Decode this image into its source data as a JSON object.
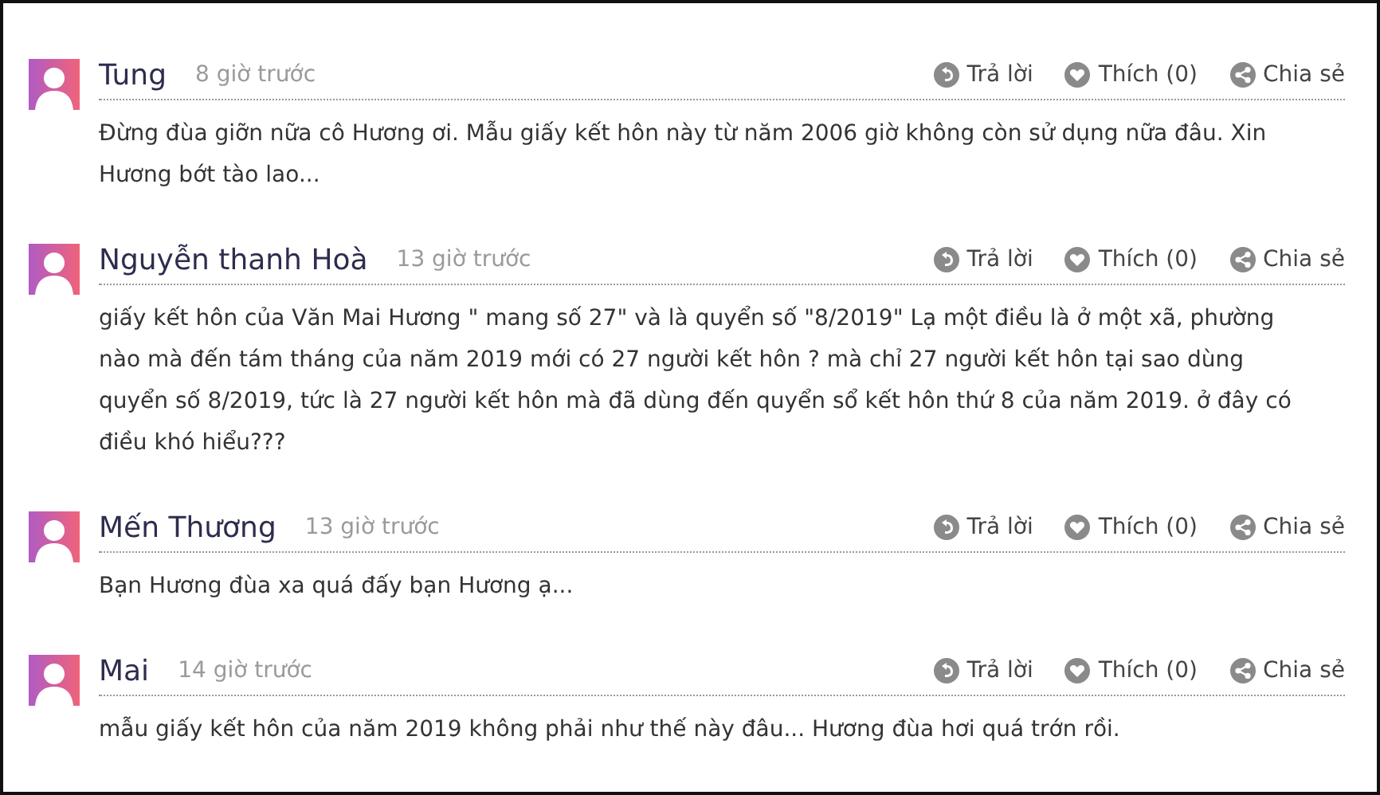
{
  "comments": [
    {
      "author": "Tung",
      "time": "8 giờ trước",
      "actions": [
        "Trả lời",
        "Thích (0)",
        "Chia sẻ"
      ],
      "text": "Đừng đùa giỡn nữa cô Hương ơi. Mẫu giấy kết hôn này từ năm 2006 giờ không còn sử dụng nữa đâu. Xin Hương bớt tào lao..."
    },
    {
      "author": "Nguyễn thanh Hoà",
      "time": "13 giờ trước",
      "actions": [
        "Trả lời",
        "Thích (0)",
        "Chia sẻ"
      ],
      "text": "giấy kết hôn của Văn Mai Hương \" mang số 27\" và là quyển số \"8/2019\" Lạ một điều là ở một xã, phường nào mà đến tám tháng của năm 2019 mới có 27 người kết hôn ? mà chỉ 27 người kết hôn tại sao dùng quyển số 8/2019, tức là 27 người kết hôn mà đã dùng đến quyển sổ kết hôn thứ 8 của năm 2019. ở đây có điều khó hiểu???"
    },
    {
      "author": "Mến Thương",
      "time": "13 giờ trước",
      "actions": [
        "Trả lời",
        "Thích (0)",
        "Chia sẻ"
      ],
      "text": "Bạn Hương đùa xa quá đấy bạn Hương ạ..."
    },
    {
      "author": "Mai",
      "time": "14 giờ trước",
      "actions": [
        "Trả lời",
        "Thích (0)",
        "Chia sẻ"
      ],
      "text": "mẫu giấy kết hôn của năm 2019 không phải như thế này đâu... Hương đùa hơi quá trớn rồi."
    }
  ]
}
